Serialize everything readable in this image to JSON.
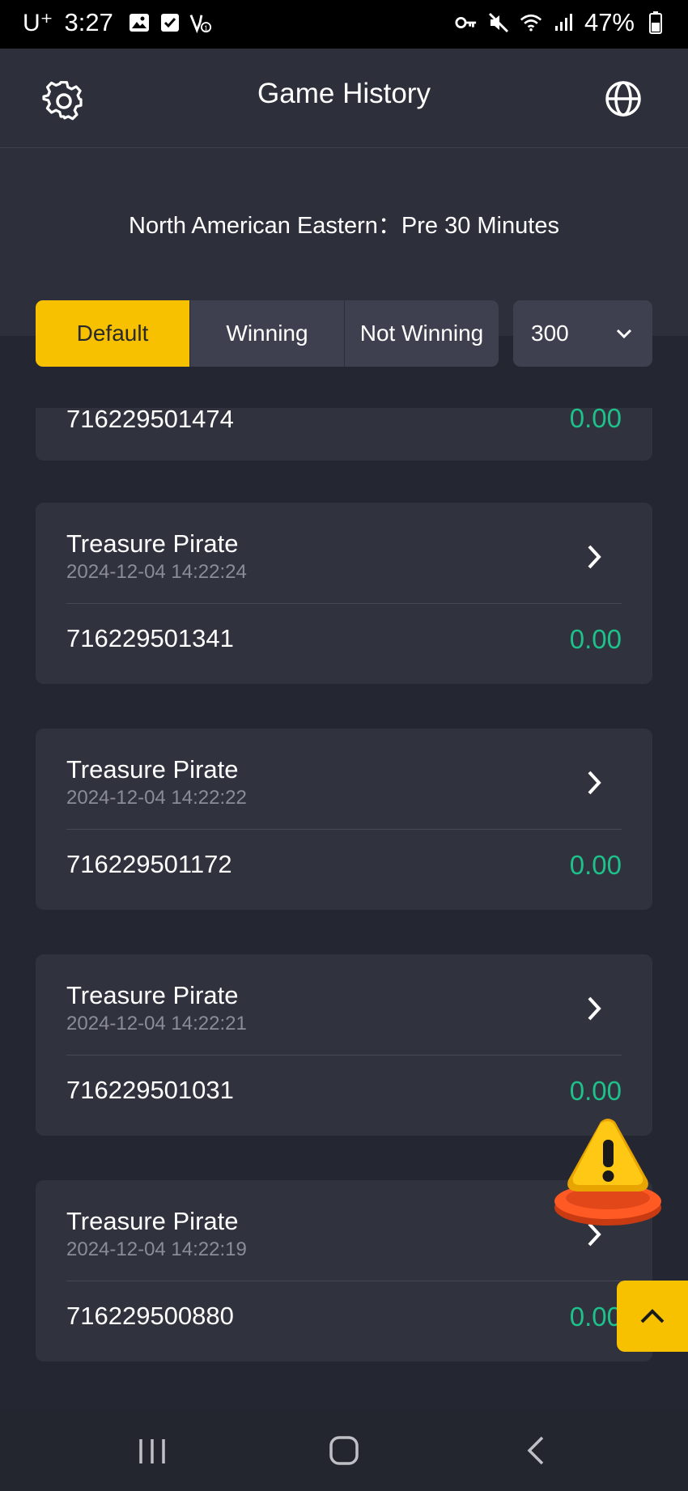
{
  "status_bar": {
    "carrier": "U⁺",
    "time": "3:27",
    "battery": "47%"
  },
  "header": {
    "title": "Game History"
  },
  "timezone": {
    "label": "North American Eastern：Pre 30 Minutes"
  },
  "filters": {
    "tabs": [
      {
        "label": "Default",
        "active": true
      },
      {
        "label": "Winning",
        "active": false
      },
      {
        "label": "Not Winning",
        "active": false
      }
    ],
    "count": "300"
  },
  "records": {
    "partial": {
      "id": "716229501474",
      "amount": "0.00"
    },
    "items": [
      {
        "game": "Treasure Pirate",
        "date": "2024-12-04 14:22:24",
        "id": "716229501341",
        "amount": "0.00"
      },
      {
        "game": "Treasure Pirate",
        "date": "2024-12-04 14:22:22",
        "id": "716229501172",
        "amount": "0.00"
      },
      {
        "game": "Treasure Pirate",
        "date": "2024-12-04 14:22:21",
        "id": "716229501031",
        "amount": "0.00"
      },
      {
        "game": "Treasure Pirate",
        "date": "2024-12-04 14:22:19",
        "id": "716229500880",
        "amount": "0.00"
      }
    ]
  },
  "colors": {
    "accent": "#f7c100",
    "amount": "#1ec18a",
    "card": "#30323e",
    "background": "#242631"
  },
  "icons": {
    "settings": "gear-icon",
    "language": "globe-icon",
    "select": "chevron-down-icon",
    "detail": "chevron-right-icon",
    "alert": "warning-icon",
    "scroll_top": "chevron-up-icon"
  }
}
